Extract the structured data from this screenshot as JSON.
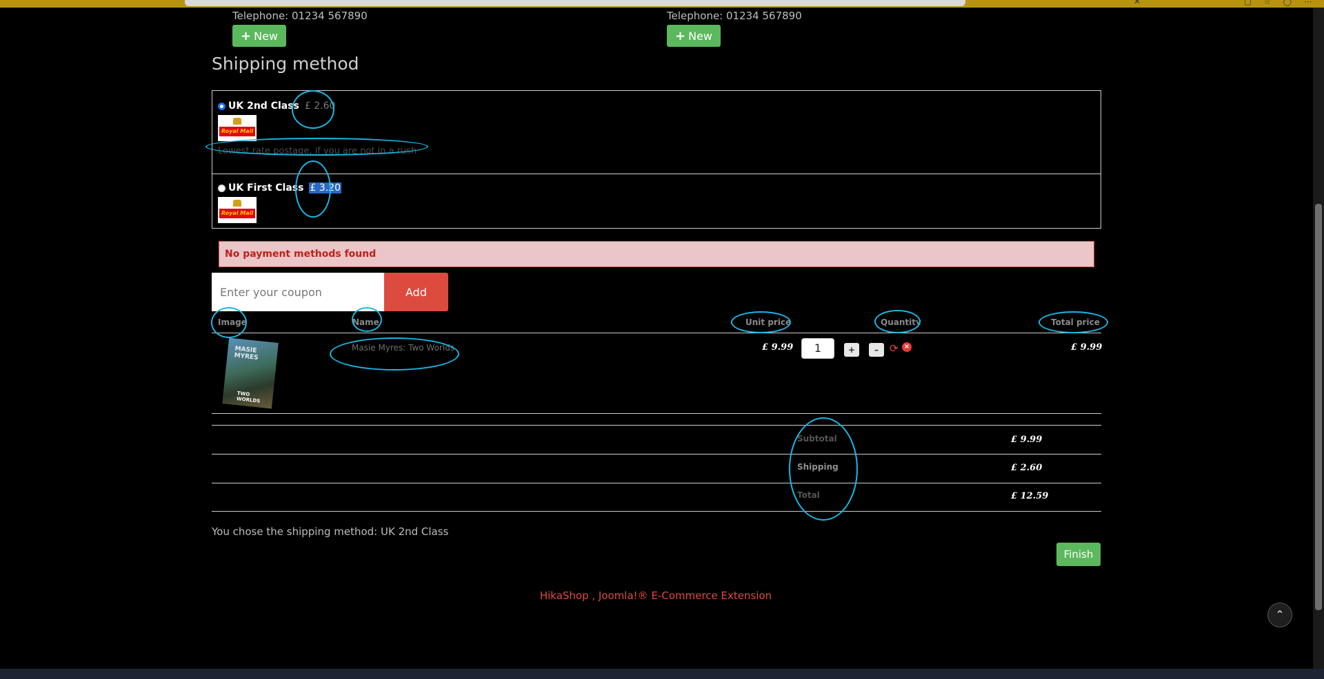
{
  "addresses": [
    {
      "telephone": "Telephone: 01234 567890",
      "new_label": "New"
    },
    {
      "telephone": "Telephone: 01234 567890",
      "new_label": "New"
    }
  ],
  "shipping": {
    "title": "Shipping method",
    "options": [
      {
        "name": "UK 2nd Class",
        "price": "£ 2.60",
        "logo_text": "Royal Mail",
        "description": "Lowest rate postage, if you are not in a rush",
        "selected": true
      },
      {
        "name": "UK First Class",
        "price": "£ 3.20",
        "logo_text": "Royal Mail",
        "selected": false
      }
    ]
  },
  "payment_alert": "No payment methods found",
  "coupon": {
    "placeholder": "Enter your coupon",
    "add_label": "Add"
  },
  "cart": {
    "headers": {
      "image": "Image",
      "name": "Name",
      "unit_price": "Unit price",
      "quantity": "Quantity",
      "total_price": "Total price"
    },
    "items": [
      {
        "cover_title": "MASIE MYRES",
        "cover_sub": "TWO WORLDS",
        "name": "Masie Myres: Two Worlds",
        "unit_price": "£ 9.99",
        "quantity": "1",
        "plus": "+",
        "minus": "–",
        "total": "£ 9.99"
      }
    ]
  },
  "totals": {
    "subtotal_label": "Subtotal",
    "subtotal": "£ 9.99",
    "shipping_label": "Shipping",
    "shipping": "£ 2.60",
    "total_label": "Total",
    "total": "£ 12.59"
  },
  "chosen_text": "You chose the shipping method: UK 2nd Class",
  "finish_label": "Finish",
  "footer": "HikaShop , Joomla!® E-Commerce Extension",
  "colors": {
    "primary_green": "#5cb85c",
    "add_red": "#dc4b3e",
    "alert_bg": "#ebc5c7",
    "annotation": "#19b8e6"
  }
}
